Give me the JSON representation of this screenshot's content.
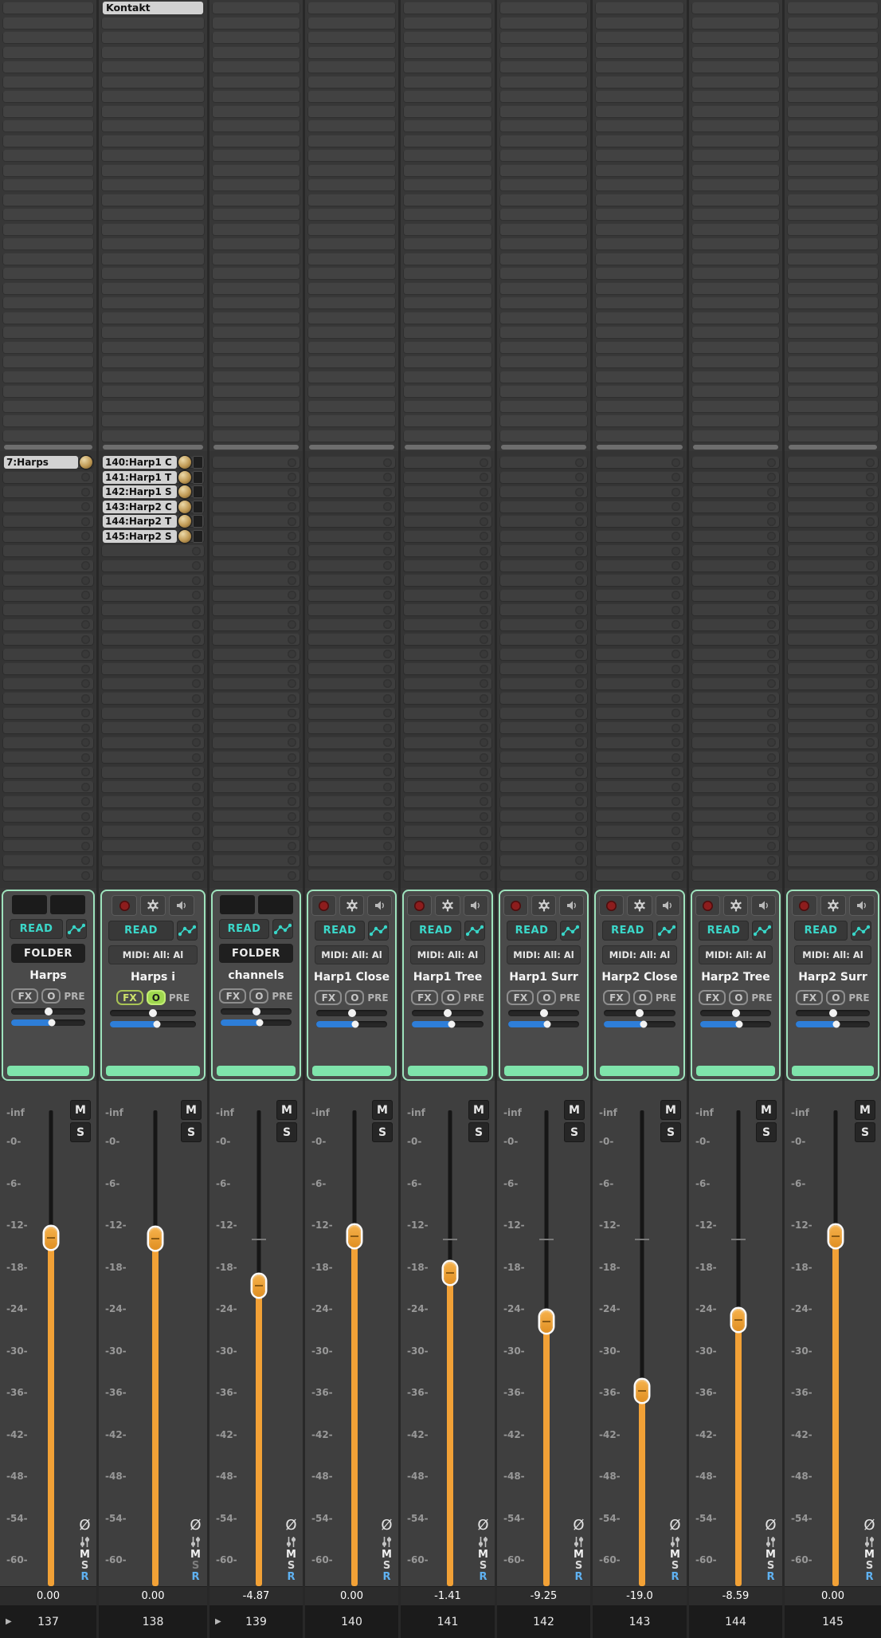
{
  "strip_controls": {
    "automation_mode": "READ",
    "fx": "FX",
    "mon": "O",
    "pre": "PRE",
    "mute": "M",
    "solo": "S",
    "phase": "Ø",
    "bottom_m": "M",
    "bottom_s": "S",
    "bottom_r": "R",
    "folder_arrow": "▶"
  },
  "db_scale": [
    "-inf",
    "-0-",
    "-6-",
    "-12-",
    "-18-",
    "-24-",
    "-30-",
    "-36-",
    "-42-",
    "-48-",
    "-54-",
    "-60-"
  ],
  "colors": {
    "panel_border": "#9ee3bd",
    "meter_green": "#7fe4ab",
    "fader_orange": "#f2a136",
    "automation_teal": "#38d6c8",
    "width_blue": "#2e7ed8",
    "receive_blue": "#5fb2f2",
    "knob_gold": "#c09a55"
  },
  "tracks": [
    {
      "number": "137",
      "name": "Harps",
      "folder": true,
      "mode_label": "FOLDER",
      "value": "0.00",
      "fader_pos": 0.268,
      "pan_pos": 0.5,
      "width_fill": 0.55,
      "fx_active": false,
      "s_dim": false,
      "inserts": [],
      "sends": [
        {
          "label": "7:Harps",
          "has_button": false
        }
      ]
    },
    {
      "number": "138",
      "name": "Harps i",
      "folder": false,
      "mode_label": "MIDI: All: Al",
      "value": "0.00",
      "fader_pos": 0.27,
      "pan_pos": 0.5,
      "width_fill": 0.55,
      "fx_active": true,
      "s_dim": true,
      "inserts": [
        {
          "label": "Kontakt"
        }
      ],
      "sends": [
        {
          "label": "140:Harp1 C",
          "has_button": true
        },
        {
          "label": "141:Harp1 T",
          "has_button": true
        },
        {
          "label": "142:Harp1 S",
          "has_button": true
        },
        {
          "label": "143:Harp2 C",
          "has_button": true
        },
        {
          "label": "144:Harp2 T",
          "has_button": true
        },
        {
          "label": "145:Harp2 S",
          "has_button": true
        }
      ]
    },
    {
      "number": "139",
      "name": "channels",
      "folder": true,
      "mode_label": "FOLDER",
      "value": "-4.87",
      "fader_pos": 0.369,
      "pan_pos": 0.5,
      "width_fill": 0.55,
      "fx_active": false,
      "s_dim": false,
      "inserts": [],
      "sends": []
    },
    {
      "number": "140",
      "name": "Harp1 Close",
      "folder": false,
      "mode_label": "MIDI: All: Al",
      "value": "0.00",
      "fader_pos": 0.264,
      "pan_pos": 0.5,
      "width_fill": 0.55,
      "fx_active": false,
      "s_dim": false,
      "inserts": [],
      "sends": []
    },
    {
      "number": "141",
      "name": "Harp1 Tree",
      "folder": false,
      "mode_label": "MIDI: All: Al",
      "value": "-1.41",
      "fader_pos": 0.341,
      "pan_pos": 0.5,
      "width_fill": 0.55,
      "fx_active": false,
      "s_dim": false,
      "inserts": [],
      "sends": []
    },
    {
      "number": "142",
      "name": "Harp1 Surr",
      "folder": false,
      "mode_label": "MIDI: All: Al",
      "value": "-9.25",
      "fader_pos": 0.444,
      "pan_pos": 0.5,
      "width_fill": 0.55,
      "fx_active": false,
      "s_dim": false,
      "inserts": [],
      "sends": []
    },
    {
      "number": "143",
      "name": "Harp2 Close",
      "folder": false,
      "mode_label": "MIDI: All: Al",
      "value": "-19.0",
      "fader_pos": 0.589,
      "pan_pos": 0.5,
      "width_fill": 0.55,
      "fx_active": false,
      "s_dim": false,
      "inserts": [],
      "sends": []
    },
    {
      "number": "144",
      "name": "Harp2 Tree",
      "folder": false,
      "mode_label": "MIDI: All: Al",
      "value": "-8.59",
      "fader_pos": 0.44,
      "pan_pos": 0.5,
      "width_fill": 0.55,
      "fx_active": false,
      "s_dim": false,
      "inserts": [],
      "sends": []
    },
    {
      "number": "145",
      "name": "Harp2 Surr",
      "folder": false,
      "mode_label": "MIDI: All: Al",
      "value": "0.00",
      "fader_pos": 0.264,
      "pan_pos": 0.5,
      "width_fill": 0.55,
      "fx_active": false,
      "s_dim": false,
      "inserts": [],
      "sends": []
    }
  ]
}
